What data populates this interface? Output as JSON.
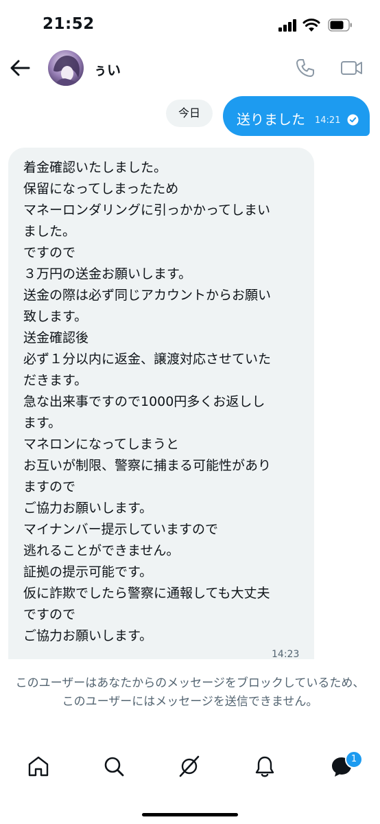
{
  "status_bar": {
    "time": "21:52"
  },
  "header": {
    "username": "ぅい",
    "icons": {
      "back": "arrow-left-icon",
      "call": "phone-icon",
      "video": "video-camera-icon"
    }
  },
  "conversation": {
    "date_label": "今日",
    "sent_message": {
      "text": "送りました",
      "time": "14:21",
      "status_icon": "read-check-icon"
    },
    "received_message": {
      "lines": [
        "着金確認いたしました。",
        "保留になってしまったため",
        "マネーロンダリングに引っかかってしまい",
        "ました。",
        "ですので",
        "３万円の送金お願いします。",
        "送金の際は必ず同じアカウントからお願い",
        "致します。",
        "送金確認後",
        "必ず１分以内に返金、譲渡対応させていた",
        "だきます。",
        "急な出来事ですので1000円多くお返しし",
        "ます。",
        "マネロンになってしまうと",
        "お互いが制限、警察に捕まる可能性があり",
        "ますので",
        "ご協力お願いします。",
        "マイナンバー提示していますので",
        "逃れることができません。",
        "証拠の提示可能です。",
        "仮に詐欺でしたら警察に通報しても大丈夫",
        "ですので",
        "ご協力お願いします。"
      ],
      "time": "14:23"
    }
  },
  "blocked_notice": "このユーザーはあなたからのメッセージをブロックしているため、このユーザーにはメッセージを送信できません。",
  "bottom_nav": {
    "items": [
      "home-icon",
      "search-icon",
      "grok-icon",
      "bell-icon",
      "messages-icon"
    ],
    "messages_badge": "1"
  },
  "colors": {
    "accent": "#1d9bf0",
    "bubble_gray": "#eff3f4",
    "secondary_text": "#536471"
  }
}
